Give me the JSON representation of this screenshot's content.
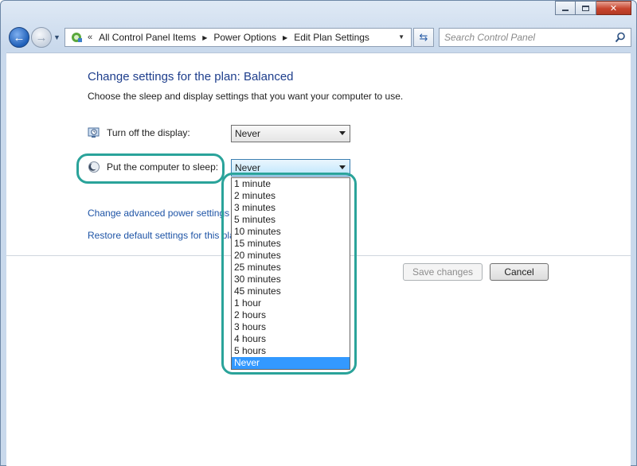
{
  "window": {
    "minimize_icon": "minimize-icon",
    "maximize_icon": "maximize-icon",
    "close_icon": "close-icon"
  },
  "nav": {
    "back_icon": "back-arrow-icon",
    "forward_icon": "forward-arrow-icon",
    "history_icon": "chevron-down-icon",
    "address_icon": "control-panel-icon",
    "overflow_label": "«",
    "breadcrumbs": [
      "All Control Panel Items",
      "Power Options",
      "Edit Plan Settings"
    ],
    "refresh_icon": "refresh-icon",
    "search_placeholder": "Search Control Panel",
    "search_icon": "search-icon"
  },
  "page": {
    "title": "Change settings for the plan: Balanced",
    "subtitle": "Choose the sleep and display settings that you want your computer to use."
  },
  "settings": {
    "display": {
      "label": "Turn off the display:",
      "value": "Never",
      "icon": "monitor-clock-icon"
    },
    "sleep": {
      "label": "Put the computer to sleep:",
      "value": "Never",
      "icon": "moon-icon"
    }
  },
  "links": {
    "advanced": "Change advanced power settings",
    "restore": "Restore default settings for this plan"
  },
  "buttons": {
    "save": "Save changes",
    "cancel": "Cancel"
  },
  "sleep_dropdown": {
    "options": [
      "1 minute",
      "2 minutes",
      "3 minutes",
      "5 minutes",
      "10 minutes",
      "15 minutes",
      "20 minutes",
      "25 minutes",
      "30 minutes",
      "45 minutes",
      "1 hour",
      "2 hours",
      "3 hours",
      "4 hours",
      "5 hours",
      "Never"
    ],
    "selected": "Never"
  },
  "colors": {
    "highlight": "#2aa39a",
    "selection": "#3399ff",
    "title": "#1e3e8c",
    "link": "#1e54a6"
  }
}
